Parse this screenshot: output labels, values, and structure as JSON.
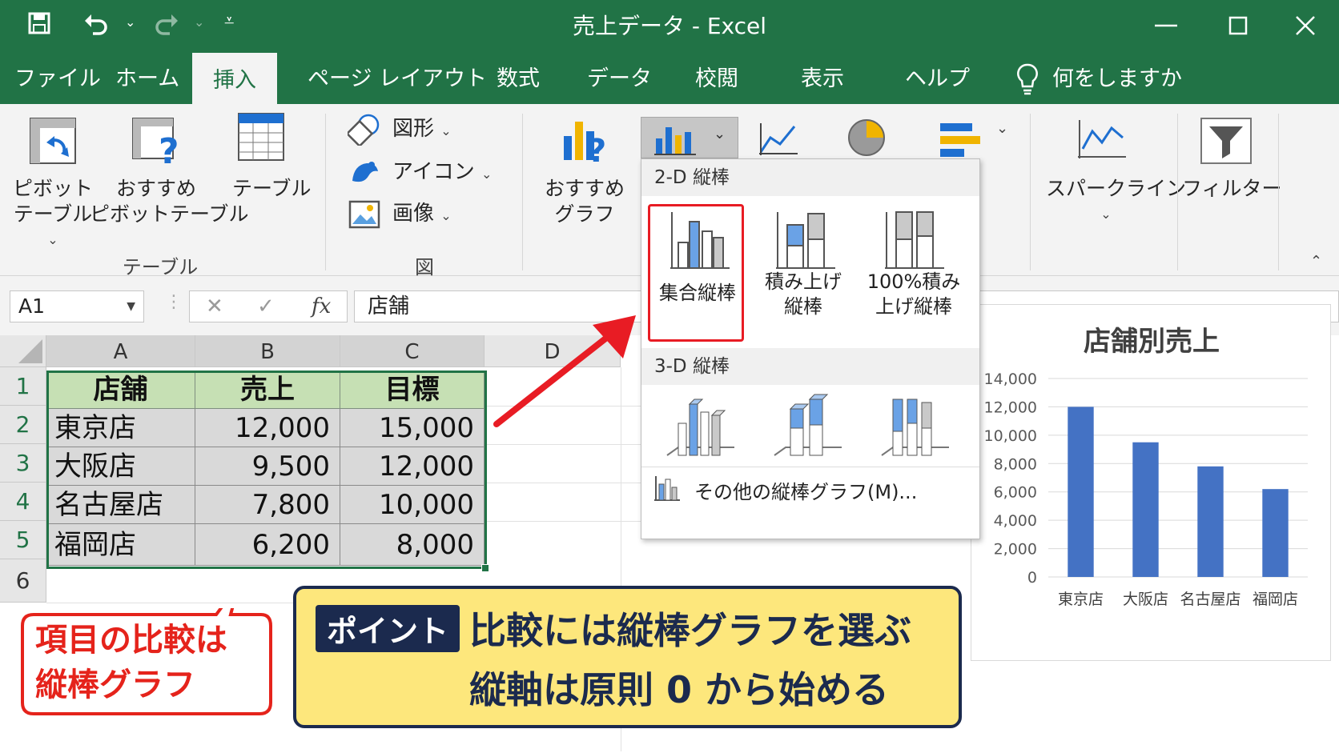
{
  "window": {
    "title": "売上データ  -  Excel"
  },
  "quick_access": {
    "save_icon": "save-icon",
    "undo_icon": "undo-icon",
    "redo_icon": "redo-icon",
    "customize_icon": "customize-qat-icon"
  },
  "tabs": [
    {
      "label": "ファイル"
    },
    {
      "label": "ホーム"
    },
    {
      "label": "挿入"
    },
    {
      "label": "ページ レイアウト"
    },
    {
      "label": "数式"
    },
    {
      "label": "データ"
    },
    {
      "label": "校閲"
    },
    {
      "label": "表示"
    },
    {
      "label": "ヘルプ"
    }
  ],
  "tell_me": "何をしますか",
  "ribbon": {
    "pivot_table_label": "ピボット\nテーブル",
    "recommended_pivot_label": "おすすめ\nピボットテーブル",
    "table_label": "テーブル",
    "group_tables": "テーブル",
    "shapes_label": "図形",
    "icons_label": "アイコン",
    "image_label": "画像",
    "group_illustrations": "図",
    "recommended_charts_label": "おすすめ\nグラフ",
    "sparkline_label": "スパークライン",
    "filter_label": "フィルター"
  },
  "formula_bar": {
    "name_box": "A1",
    "cancel": "✕",
    "enter": "✓",
    "fx": "fx",
    "value": "店舗"
  },
  "sheet": {
    "columns": [
      "A",
      "B",
      "C",
      "D"
    ],
    "rows": [
      "1",
      "2",
      "3",
      "4",
      "5",
      "6"
    ],
    "header": [
      "店舗",
      "売上",
      "目標"
    ],
    "data": [
      [
        "東京店",
        "12,000",
        "15,000"
      ],
      [
        "大阪店",
        "9,500",
        "12,000"
      ],
      [
        "名古屋店",
        "7,800",
        "10,000"
      ],
      [
        "福岡店",
        "6,200",
        "8,000"
      ]
    ]
  },
  "chart_menu": {
    "section_2d": "2-D 縦棒",
    "section_3d": "3-D 縦棒",
    "clustered": "集合縦棒",
    "stacked": "積み上げ\n縦棒",
    "stacked100": "100%積み\n上げ縦棒",
    "more": "その他の縦棒グラフ(M)..."
  },
  "chart_data": {
    "type": "bar",
    "title": "店舗別売上",
    "categories": [
      "東京店",
      "大阪店",
      "名古屋店",
      "福岡店"
    ],
    "values": [
      12000,
      9500,
      7800,
      6200
    ],
    "ylim": [
      0,
      14000
    ],
    "yticks": [
      "0",
      "2,000",
      "4,000",
      "6,000",
      "8,000",
      "10,000",
      "12,000",
      "14,000"
    ],
    "color": "#4472c4",
    "grid": true
  },
  "callout": {
    "text": "項目の比較は\n縦棒グラフ"
  },
  "point": {
    "badge": "ポイント",
    "line1": "比較には縦棒グラフを選ぶ",
    "line2": "縦軸は原則 0 から始める"
  },
  "colors": {
    "excel_green": "#217346",
    "header_fill": "#c6e0b4",
    "accent_red": "#e81c24",
    "note_yellow": "#fde77c",
    "navy": "#1b2a4e"
  }
}
